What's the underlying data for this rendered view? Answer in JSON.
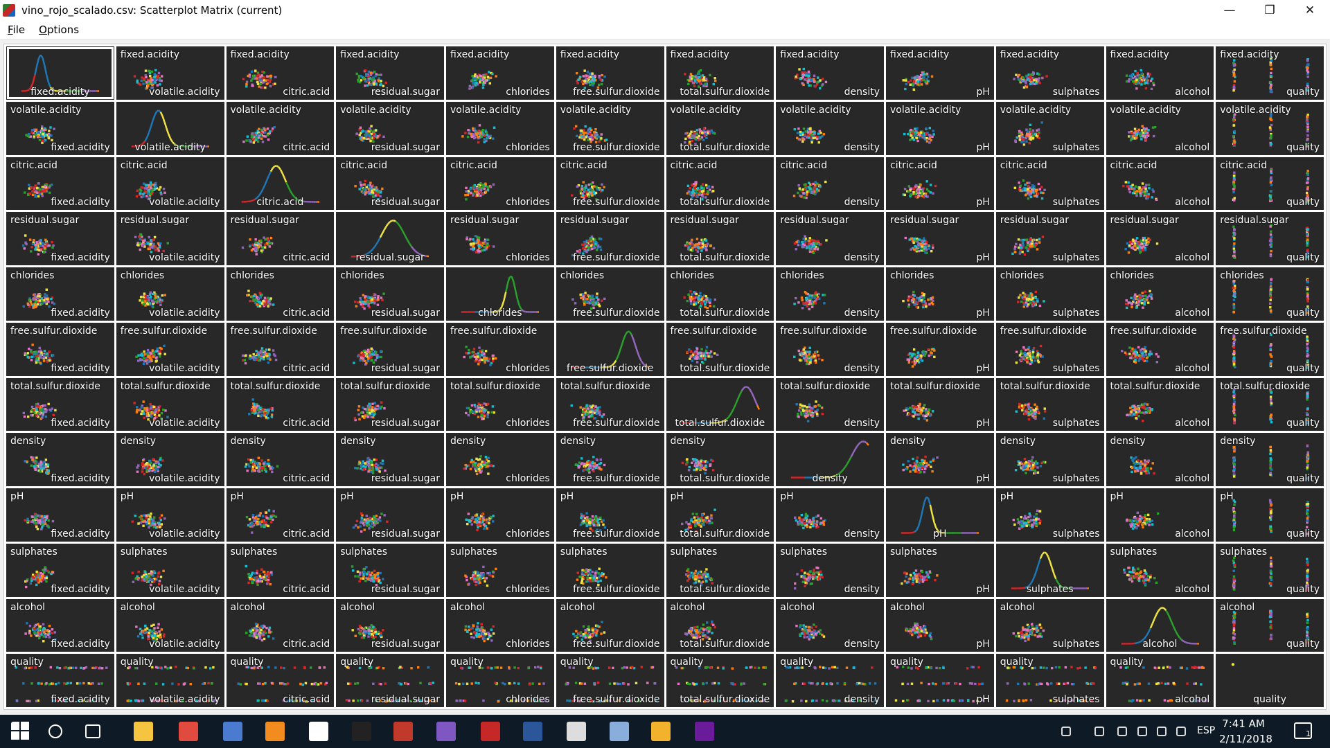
{
  "window": {
    "title": "vino_rojo_scalado.csv: Scatterplot Matrix (current)",
    "app_icon": "r-ggobi-icon",
    "controls": [
      "minimize-icon",
      "restore-icon",
      "close-icon"
    ]
  },
  "menubar": {
    "items": [
      {
        "label": "File",
        "underline_index": 0
      },
      {
        "label": "Options",
        "underline_index": 0
      }
    ]
  },
  "matrix": {
    "variables": [
      "fixed.acidity",
      "volatile.acidity",
      "citric.acid",
      "residual.sugar",
      "chlorides",
      "free.sulfur.dioxide",
      "total.sulfur.dioxide",
      "density",
      "pH",
      "sulphates",
      "alcohol",
      "quality"
    ],
    "selected_cell": "fixed.acidity",
    "point_colors": [
      "#d62728",
      "#1f77b4",
      "#f0e442",
      "#2ca02c",
      "#9467bd",
      "#ff7f0e",
      "#e377c2",
      "#17becf"
    ],
    "background": "#282828",
    "label_color": "#ffffff"
  },
  "taskbar": {
    "pinned": [
      "start-icon",
      "search-icon",
      "task-view-icon",
      "file-explorer-icon",
      "chrome-icon",
      "r-icon",
      "sublime-text-icon",
      "mail-icon",
      "terminal-icon",
      "ggobi-icon",
      "visual-studio-icon",
      "acrobat-icon",
      "word-icon",
      "photos-icon",
      "ie-icon",
      "paint-icon",
      "ggobi-active-icon"
    ],
    "tray": {
      "icons": [
        "people-icon",
        "chevron-up-icon",
        "dropbox-icon",
        "battery-icon",
        "wifi-icon",
        "volume-icon"
      ],
      "language": "ESP",
      "time": "7:41 AM",
      "date": "2/11/2018",
      "notification_count": "1"
    }
  }
}
